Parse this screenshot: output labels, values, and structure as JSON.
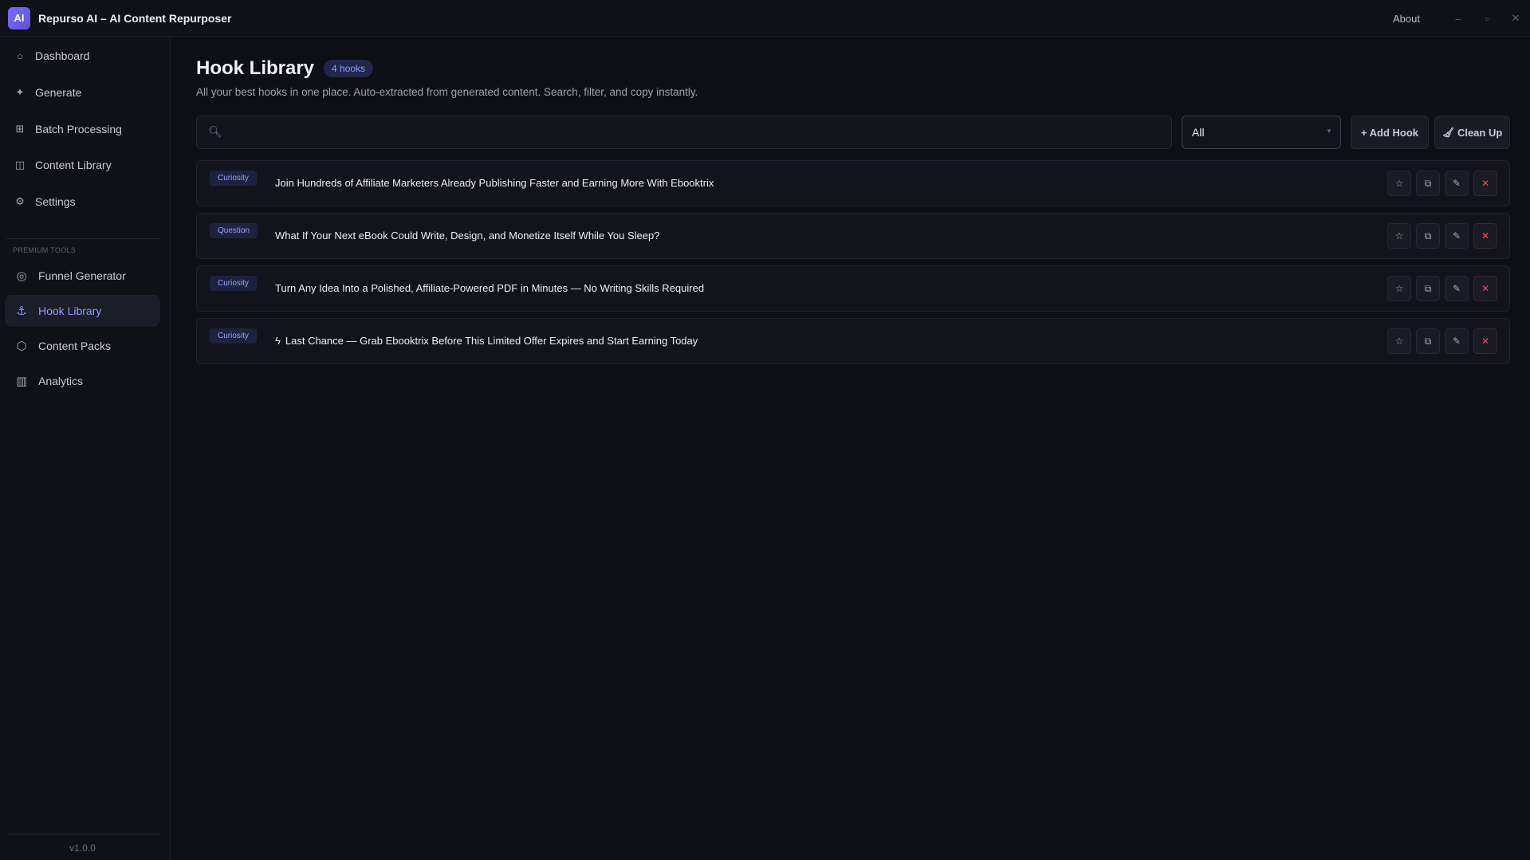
{
  "window": {
    "logo_text": "AI",
    "title": "Repurso AI – AI Content Repurposer",
    "about_label": "About",
    "controls": [
      "–",
      "▫",
      "✕"
    ]
  },
  "sidebar": {
    "items": [
      {
        "label": "Dashboard",
        "icon": "circle-icon"
      },
      {
        "label": "Generate",
        "icon": "sparkle-icon"
      },
      {
        "label": "Batch Processing",
        "icon": "grid-icon"
      },
      {
        "label": "Content Library",
        "icon": "columns-icon"
      },
      {
        "label": "Settings",
        "icon": "gear-icon"
      }
    ],
    "section_label": "PREMIUM TOOLS",
    "premium_items": [
      {
        "label": "Funnel Generator",
        "icon": "target-icon"
      },
      {
        "label": "Hook Library",
        "icon": "anchor-icon",
        "active": true
      },
      {
        "label": "Content Packs",
        "icon": "package-icon"
      },
      {
        "label": "Analytics",
        "icon": "bar-chart-icon"
      }
    ],
    "version": "v1.0.0"
  },
  "main": {
    "title": "Hook Library",
    "count_badge": "4 hooks",
    "subtitle": "All your best hooks in one place. Auto-extracted from generated content. Search, filter, and copy instantly.",
    "search": {
      "placeholder": "",
      "value": ""
    },
    "filter": {
      "selected": "All"
    },
    "add_button": "+ Add Hook",
    "clean_button": "Clean Up",
    "hooks": [
      {
        "tag": "Curiosity",
        "text": "Join Hundreds of Affiliate Marketers Already Publishing Faster and Earning More With Ebooktrix",
        "prefix_icon": ""
      },
      {
        "tag": "Question",
        "text": "What If Your Next eBook Could Write, Design, and Monetize Itself While You Sleep?",
        "prefix_icon": ""
      },
      {
        "tag": "Curiosity",
        "text": "Turn Any Idea Into a Polished, Affiliate-Powered PDF in Minutes — No Writing Skills Required",
        "prefix_icon": ""
      },
      {
        "tag": "Curiosity",
        "text": "Last Chance — Grab Ebooktrix Before This Limited Offer Expires and Start Earning Today",
        "prefix_icon": "lightning-icon"
      }
    ],
    "row_actions": [
      "star-icon",
      "copy-icon",
      "pencil-icon",
      "delete-icon"
    ]
  },
  "colors": {
    "background": "#0e0f14",
    "accent": "#8e9bff",
    "danger": "#e05555"
  }
}
